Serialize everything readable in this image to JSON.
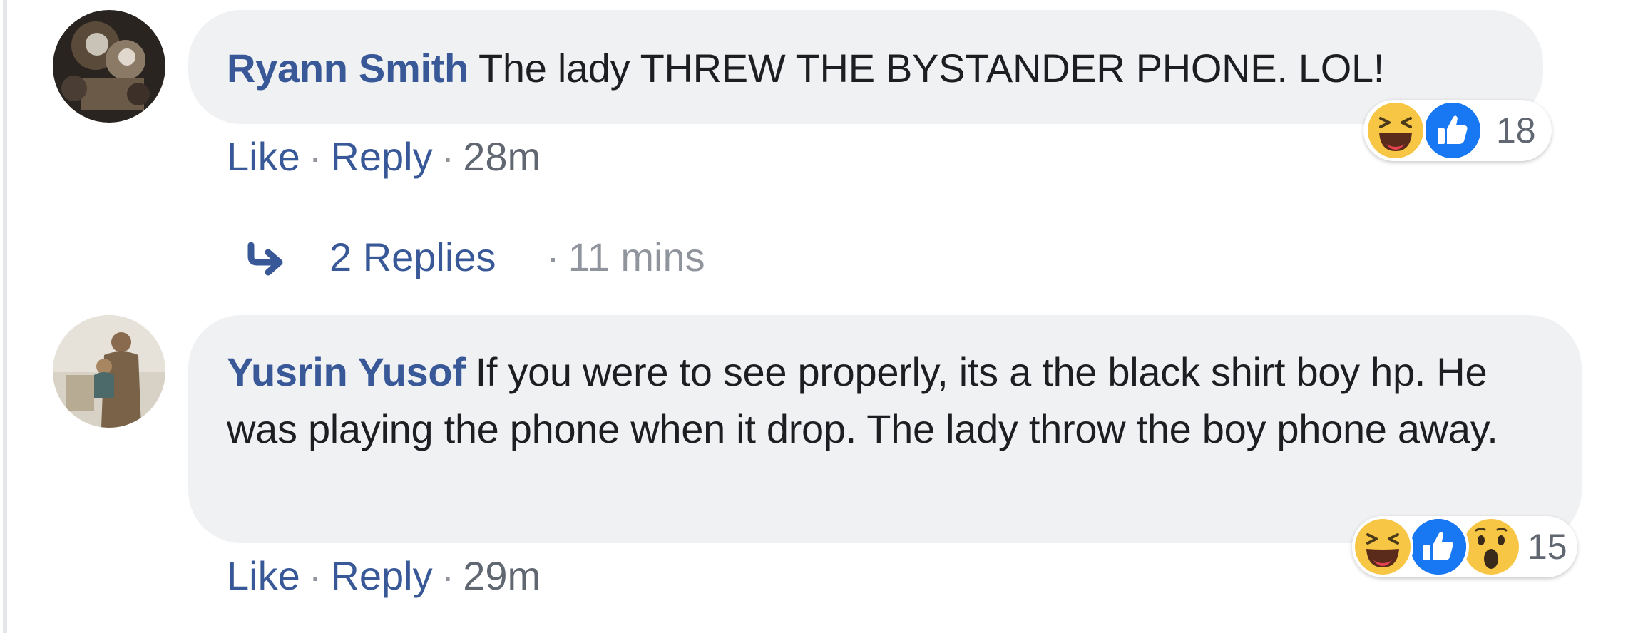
{
  "comments": [
    {
      "author": "Ryann Smith",
      "text": "The lady THREW THE BYSTANDER PHONE. LOL!",
      "like_label": "Like",
      "reply_label": "Reply",
      "time": "28m",
      "separator": "·",
      "reactions": [
        "haha",
        "like"
      ],
      "reaction_count": "18"
    },
    {
      "author": "Yusrin Yusof",
      "text": "If you were to see properly, its a the black shirt boy hp. He was playing the phone when it drop. The lady throw the boy phone away.",
      "like_label": "Like",
      "reply_label": "Reply",
      "time": "29m",
      "separator": "·",
      "reactions": [
        "haha",
        "like",
        "wow"
      ],
      "reaction_count": "15"
    }
  ],
  "replies": {
    "label": "2 Replies",
    "separator": "·",
    "time": "11 mins",
    "icon": "reply-arrow-icon"
  },
  "colors": {
    "link_blue": "#385898",
    "bubble_bg": "#f0f1f3",
    "text": "#1c1e21",
    "meta_gray": "#606770",
    "like_blue": "#1877f2",
    "emoji_yellow": "#f7c645"
  }
}
